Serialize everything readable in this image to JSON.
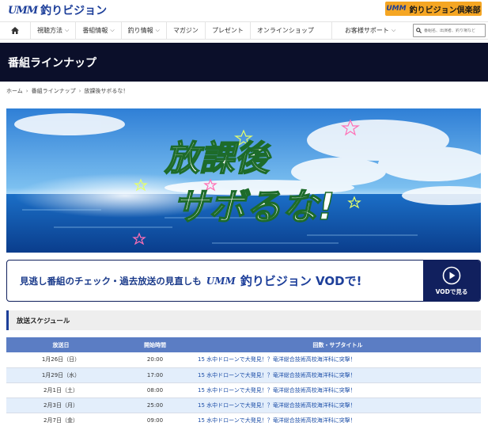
{
  "header": {
    "logo_mark": "UMM",
    "logo_text": "釣りビジョン",
    "club_mark": "UMM",
    "club_label": "釣りビジョン倶楽部"
  },
  "nav": {
    "items": [
      {
        "label": "視聴方法",
        "dropdown": true
      },
      {
        "label": "番組情報",
        "dropdown": true
      },
      {
        "label": "釣り情報",
        "dropdown": true
      },
      {
        "label": "マガジン",
        "dropdown": false
      },
      {
        "label": "プレゼント",
        "dropdown": false
      },
      {
        "label": "オンラインショップ",
        "dropdown": false
      },
      {
        "label": "お客様サポート",
        "dropdown": true
      }
    ],
    "search_placeholder": "番組名、出演者、釣り場など"
  },
  "page_title": "番組ラインナップ",
  "breadcrumb": [
    "ホーム",
    "番組ラインナップ",
    "放課後サボるな！"
  ],
  "hero": {
    "logo_line1": "放課後",
    "logo_line2": "サボるな!"
  },
  "vod_banner": {
    "text1": "見逃し番組のチェック・過去放送の見直しも",
    "mark": "UMM",
    "text2": "釣りビジョン VODで!",
    "button_label": "VODで見る"
  },
  "schedule": {
    "heading": "放送スケジュール",
    "columns": [
      "放送日",
      "開始時間",
      "回数・サブタイトル"
    ],
    "rows": [
      {
        "date": "1月26日（日）",
        "time": "20:00",
        "title": "15 水中ドローンで大発見！？竜洋総合技術高校海洋科に突撃！"
      },
      {
        "date": "1月29日（水）",
        "time": "17:00",
        "title": "15 水中ドローンで大発見！？竜洋総合技術高校海洋科に突撃！"
      },
      {
        "date": "2月1日（土）",
        "time": "08:00",
        "title": "15 水中ドローンで大発見！？竜洋総合技術高校海洋科に突撃！"
      },
      {
        "date": "2月3日（月）",
        "time": "25:00",
        "title": "15 水中ドローンで大発見！？竜洋総合技術高校海洋科に突撃！"
      },
      {
        "date": "2月7日（金）",
        "time": "09:00",
        "title": "15 水中ドローンで大発見！？竜洋総合技術高校海洋科に突撃！"
      }
    ]
  },
  "colors": {
    "brand_blue": "#1d3f9a",
    "club_orange": "#f5a623",
    "title_band": "#0b0f2a",
    "table_header": "#5b7dc4",
    "row_alt": "#e3eefb"
  }
}
